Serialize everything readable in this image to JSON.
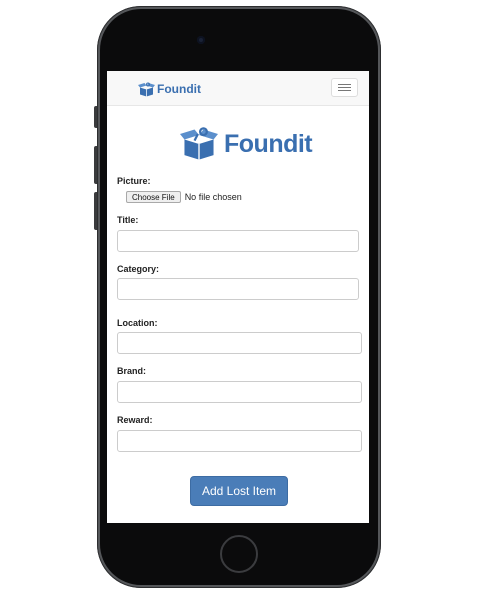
{
  "navbar": {
    "brand": "Foundit",
    "toggle_icon": "hamburger-menu-icon"
  },
  "logo": {
    "text": "Foundit",
    "icon": "open-box-icon"
  },
  "form": {
    "picture_label": "Picture:",
    "file_button": "Choose File",
    "file_status": "No file chosen",
    "title_label": "Title:",
    "category_label": "Category:",
    "location_label": "Location:",
    "brand_label": "Brand:",
    "reward_label": "Reward:",
    "submit_label": "Add Lost Item"
  },
  "colors": {
    "brand": "#3a6fb0",
    "button": "#4a7db8",
    "navbar_bg": "#f8f8f8",
    "phone_body": "#55575a"
  }
}
